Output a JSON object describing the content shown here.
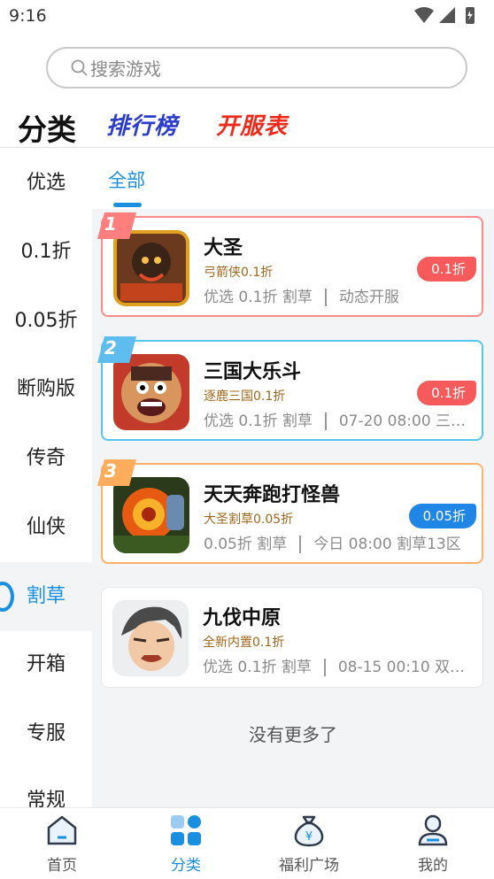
{
  "status_bar": {
    "time": "9:16"
  },
  "search": {
    "placeholder": "搜索游戏"
  },
  "header": {
    "title": "分类",
    "rank_label": "排行榜",
    "servers_label": "开服表"
  },
  "sidebar": {
    "items": [
      {
        "label": "优选"
      },
      {
        "label": "0.1折"
      },
      {
        "label": "0.05折"
      },
      {
        "label": "断购版"
      },
      {
        "label": "传奇"
      },
      {
        "label": "仙侠"
      },
      {
        "label": "割草",
        "active": true
      },
      {
        "label": "开箱"
      },
      {
        "label": "专服"
      },
      {
        "label": "常规"
      }
    ]
  },
  "tabs": {
    "all_label": "全部"
  },
  "games": [
    {
      "rank": "1",
      "name": "大圣",
      "subtitle": "弓箭侠0.1折",
      "tags": "优选  0.1折  割草",
      "extra": "动态开服",
      "discount": "0.1折",
      "discount_color": "#f75a5a"
    },
    {
      "rank": "2",
      "name": "三国大乐斗",
      "subtitle": "逐鹿三国0.1折",
      "tags": "优选  0.1折  割草",
      "extra": "07-20 08:00 三…",
      "discount": "0.1折",
      "discount_color": "#f75a5a"
    },
    {
      "rank": "3",
      "name": "天天奔跑打怪兽",
      "subtitle": "大圣割草0.05折",
      "tags": "0.05折  割草",
      "extra": "今日 08:00 割草13区",
      "discount": "0.05折",
      "discount_color": "#1f86e6"
    },
    {
      "rank": "",
      "name": "九伐中原",
      "subtitle": "全新内置0.1折",
      "tags": "优选  0.1折  割草",
      "extra": "08-15 00:10 双…",
      "discount": "",
      "discount_color": ""
    }
  ],
  "footer_text": "没有更多了",
  "bottom_nav": [
    {
      "label": "首页",
      "icon": "home-icon"
    },
    {
      "label": "分类",
      "icon": "category-icon",
      "active": true
    },
    {
      "label": "福利广场",
      "icon": "money-bag-icon"
    },
    {
      "label": "我的",
      "icon": "profile-icon"
    }
  ]
}
